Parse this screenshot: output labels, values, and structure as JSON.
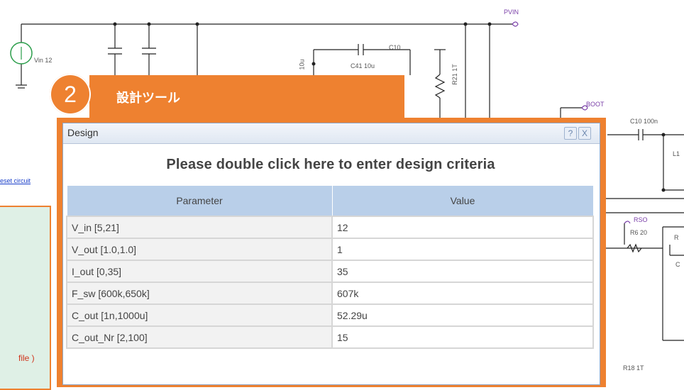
{
  "schematic": {
    "labels": {
      "pvin": "PVIN",
      "vin": "Vin 12",
      "c41": "C41 10u",
      "c41_top": "C10",
      "c41_side": "10u",
      "r21": "R21 1T",
      "boot": "BOOT",
      "c10": "C10 100n",
      "l1": "L1",
      "rso": "RSO",
      "r6": "R6 20",
      "r18": "R18 1T",
      "right_r": "R",
      "right_c": "C"
    },
    "link": "eset circuit",
    "red_text": "file )"
  },
  "step": {
    "number": "2",
    "title": "設計ツール"
  },
  "dialog": {
    "title": "Design",
    "help_label": "?",
    "close_label": "X",
    "header": "Please double click here to enter design criteria",
    "columns": [
      "Parameter",
      "Value"
    ],
    "rows": [
      {
        "parameter": "V_in [5,21]",
        "value": "12"
      },
      {
        "parameter": "V_out [1.0,1.0]",
        "value": "1"
      },
      {
        "parameter": "I_out [0,35]",
        "value": "35"
      },
      {
        "parameter": "F_sw [600k,650k]",
        "value": "607k"
      },
      {
        "parameter": "C_out [1n,1000u]",
        "value": "52.29u"
      },
      {
        "parameter": "C_out_Nr [2,100]",
        "value": "15"
      }
    ]
  },
  "colors": {
    "accent": "#ee8130",
    "table_header": "#b9cfe9",
    "panel_green": "#dff0e6"
  }
}
